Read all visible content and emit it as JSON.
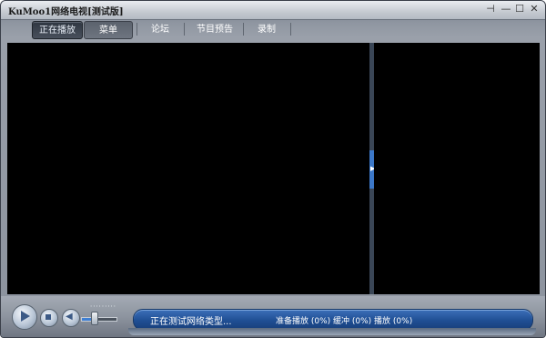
{
  "window": {
    "title": "KuMoo1网络电视[测试版]",
    "controls": {
      "pin": "⊣",
      "minimize": "—",
      "maximize": "☐",
      "close": "✕"
    }
  },
  "tabs": [
    {
      "label": "正在播放",
      "active": true
    },
    {
      "label": "菜单",
      "active": false
    },
    {
      "label": "论坛",
      "active": false
    },
    {
      "label": "节目预告",
      "active": false
    },
    {
      "label": "录制",
      "active": false
    }
  ],
  "player": {
    "play_icon": "play-icon",
    "stop_icon": "stop-icon",
    "volume_icon": "speaker-icon",
    "volume_ticks": "'''''''''",
    "volume_level": 0.35
  },
  "status": {
    "message": "正在测试网络类型...",
    "detail": "准备播放 (0%)  缓冲 (0%)  播放 (0%)"
  },
  "colors": {
    "accent": "#3c78c8",
    "status_panel": "#1f4e93",
    "video_bg": "#000000"
  }
}
